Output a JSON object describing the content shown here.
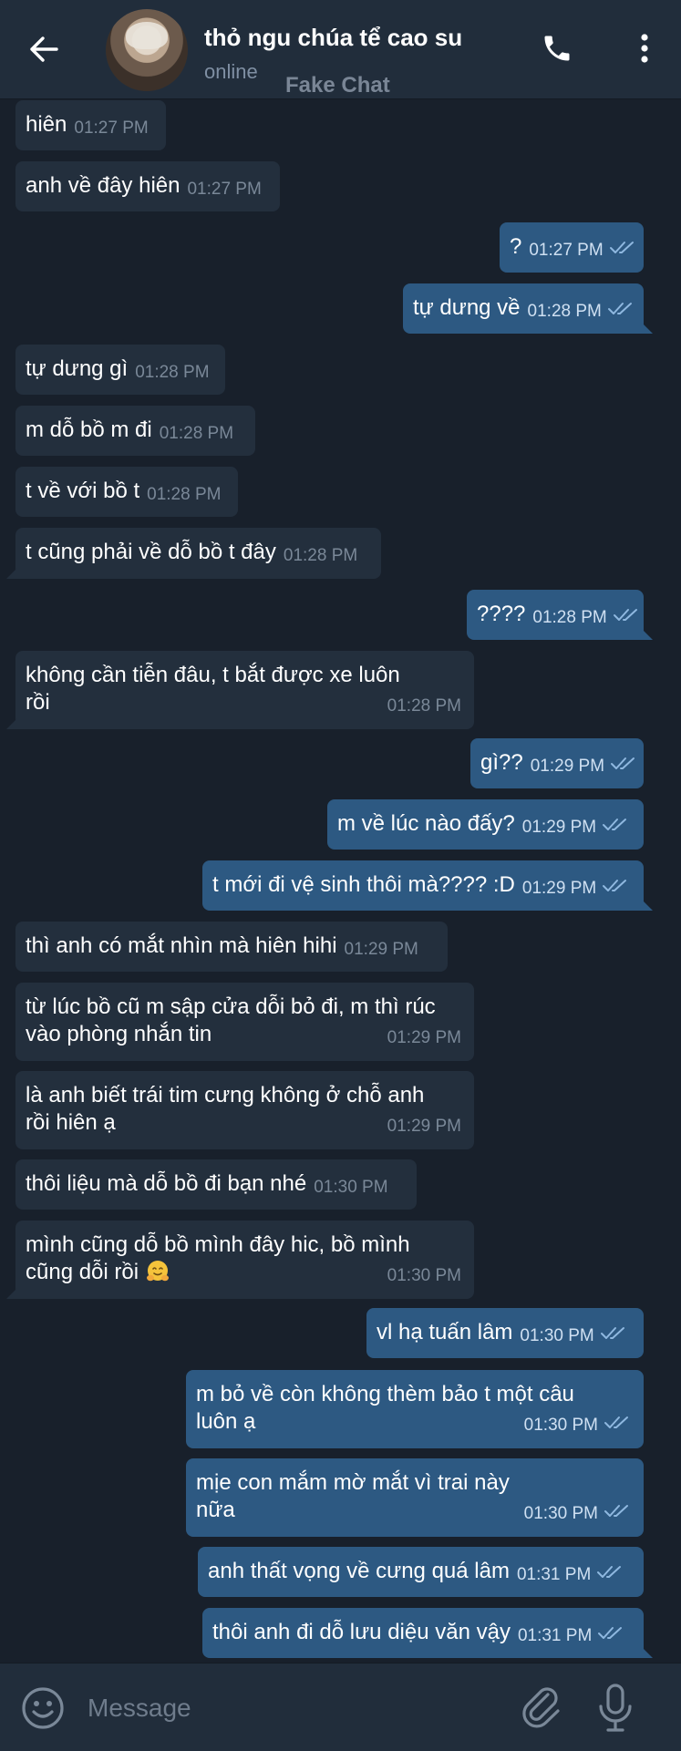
{
  "header": {
    "contact_name": "thỏ ngu chúa tể cao su",
    "status": "online",
    "watermark": "Fake Chat",
    "icons": [
      "back-arrow-icon",
      "phone-icon",
      "more-vertical-icon"
    ]
  },
  "messages": [
    {
      "dir": "in",
      "text": "hiên",
      "time": "01:27 PM"
    },
    {
      "dir": "in",
      "text": "anh về đây hiên",
      "time": "01:27 PM"
    },
    {
      "dir": "out",
      "text": "?",
      "time": "01:27 PM"
    },
    {
      "dir": "out",
      "text": "tự dưng về",
      "time": "01:28 PM"
    },
    {
      "dir": "in",
      "text": "tự dưng gì",
      "time": "01:28 PM"
    },
    {
      "dir": "in",
      "text": "m dỗ bồ m đi",
      "time": "01:28 PM"
    },
    {
      "dir": "in",
      "text": "t về với bồ t",
      "time": "01:28 PM"
    },
    {
      "dir": "in",
      "text": "t cũng phải về dỗ bồ t đây",
      "time": "01:28 PM"
    },
    {
      "dir": "out",
      "text": "????",
      "time": "01:28 PM"
    },
    {
      "dir": "in",
      "text": "không cần tiễn đâu, t bắt được xe luôn\nrồi",
      "time": "01:28 PM"
    },
    {
      "dir": "out",
      "text": "gì??",
      "time": "01:29 PM"
    },
    {
      "dir": "out",
      "text": "m về lúc nào đấy?",
      "time": "01:29 PM"
    },
    {
      "dir": "out",
      "text": "t mới đi vệ sinh thôi mà???? :D",
      "time": "01:29 PM"
    },
    {
      "dir": "in",
      "text": "thì anh có mắt nhìn mà hiên hihi",
      "time": "01:29 PM"
    },
    {
      "dir": "in",
      "text": "từ lúc bồ cũ m sập cửa dỗi bỏ đi, m thì rúc\nvào phòng nhắn tin",
      "time": "01:29 PM"
    },
    {
      "dir": "in",
      "text": "là anh biết trái tim cưng không ở chỗ anh\nrồi hiên ạ",
      "time": "01:29 PM"
    },
    {
      "dir": "in",
      "text": "thôi liệu mà dỗ bồ đi bạn nhé",
      "time": "01:30 PM"
    },
    {
      "dir": "in",
      "text": "mình cũng dỗ bồ mình đây hic, bồ mình\ncũng dỗi rồi",
      "time": "01:30 PM",
      "emoji": "hugging-face-emoji"
    },
    {
      "dir": "out",
      "text": "vl hạ tuấn lâm",
      "time": "01:30 PM"
    },
    {
      "dir": "out",
      "text": "m bỏ về còn không thèm bảo t một câu\nluôn ạ",
      "time": "01:30 PM"
    },
    {
      "dir": "out",
      "text": "mịe con mắm mờ mắt vì trai này\nnữa",
      "time": "01:30 PM"
    },
    {
      "dir": "out",
      "text": "anh thất vọng về cưng quá lâm",
      "time": "01:31 PM"
    },
    {
      "dir": "out",
      "text": "thôi anh đi dỗ lưu diệu văn vậy",
      "time": "01:31 PM"
    }
  ],
  "composer": {
    "placeholder": "Message",
    "icons": [
      "emoji-icon",
      "attach-icon",
      "mic-icon"
    ]
  },
  "colors": {
    "background": "#18202b",
    "header": "#212d3b",
    "incoming_bubble": "#232f3d",
    "outgoing_bubble": "#2d5982",
    "read_ticks": "#8fb8e0"
  }
}
